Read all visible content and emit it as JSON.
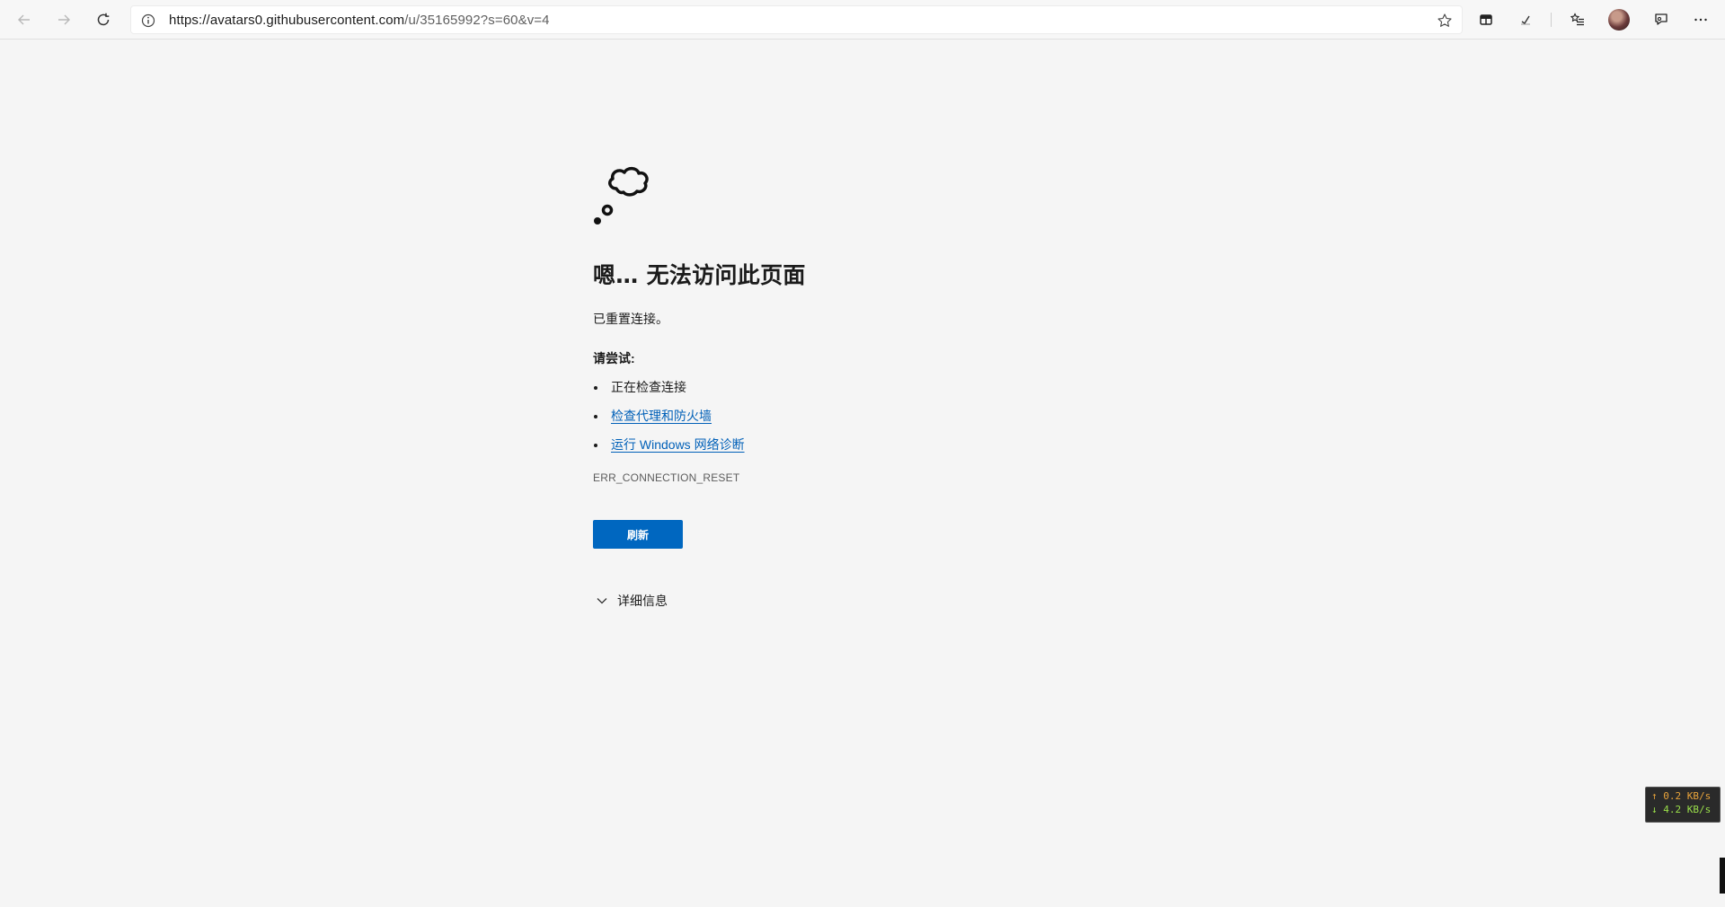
{
  "toolbar": {
    "url_host": "https://avatars0.githubusercontent.com",
    "url_path": "/u/35165992?s=60&v=4",
    "back_icon": "arrow-left-icon",
    "forward_icon": "arrow-right-icon",
    "refresh_icon": "refresh-icon",
    "info_icon": "info-icon",
    "favorite_icon": "star-icon"
  },
  "error": {
    "heading": "嗯… 无法访问此页面",
    "message": "已重置连接。",
    "try_label": "请尝试:",
    "suggestions": [
      {
        "label": "正在检查连接",
        "link": false
      },
      {
        "label": "检查代理和防火墙",
        "link": true
      },
      {
        "label": "运行 Windows 网络诊断",
        "link": true
      }
    ],
    "code": "ERR_CONNECTION_RESET",
    "refresh_label": "刷新",
    "details_label": "详细信息"
  },
  "netspeed": {
    "up": "↑ 0.2 KB/s",
    "down": "↓ 4.2 KB/s"
  },
  "colors": {
    "accent": "#0067c0",
    "link": "#0060b8",
    "background": "#f5f5f5"
  }
}
